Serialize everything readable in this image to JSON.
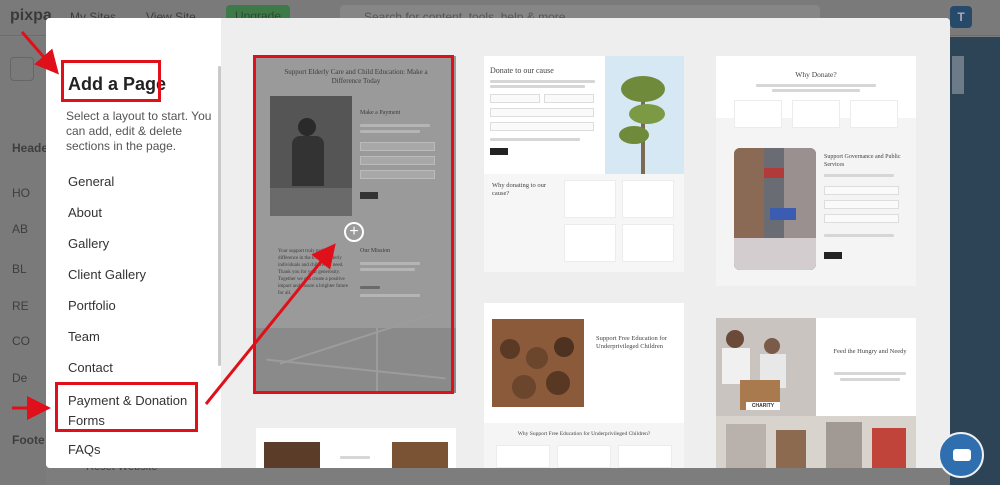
{
  "app": {
    "logo": "pixpa",
    "nav_sites": "My Sites",
    "nav_view_site": "View Site",
    "upgrade": "Upgrade",
    "search_placeholder": "Search for content, tools, help & more",
    "avatar_letter": "T",
    "side_items": [
      "Heade",
      "HO",
      "AB",
      "BL",
      "RE",
      "CO",
      "De",
      "Foote"
    ],
    "reset_label": "Reset Website"
  },
  "modal": {
    "title": "Add a Page",
    "description": "Select a layout to start. You can add, edit & delete sections in the page.",
    "categories": [
      "General",
      "About",
      "Gallery",
      "Client Gallery",
      "Portfolio",
      "Team",
      "Contact",
      "Payment & Donation Forms",
      "FAQs"
    ],
    "selected_category": "Payment & Donation Forms"
  },
  "templates": {
    "t1": {
      "title": "Support Elderly Care and Child Education: Make a Difference Today",
      "form_title": "Make a Payment",
      "body_text": "Your support truly makes a difference in the lives of elderly individuals and children in need. Thank you for your generosity. Together we can create a positive impact and ensure a brighter future for all.",
      "mission_title": "Our Mission"
    },
    "t2": {
      "title": "Donate to our cause",
      "why_title": "Why donating to our cause?"
    },
    "t3": {
      "title": "Why Donate?",
      "support_title": "Support Governance and Public Services"
    },
    "t4": {
      "title": "Support Free Education for Underprivileged Children",
      "sub_title": "Why Support Free Education for Underprivileged Children?"
    },
    "t5": {
      "title": "Feed the Hungry and Needy",
      "banner": "CHARITY"
    }
  },
  "colors": {
    "annotation_red": "#e0101a",
    "accent_green": "#2e9e48",
    "brand_dark_blue": "#274a6b"
  }
}
